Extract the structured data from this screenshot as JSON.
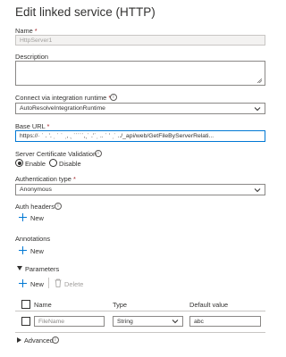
{
  "panel": {
    "title": "Edit linked service (HTTP)"
  },
  "name": {
    "label": "Name",
    "required_mark": "*",
    "value": "HttpServer1"
  },
  "description": {
    "label": "Description",
    "value": ""
  },
  "runtime": {
    "label": "Connect via integration runtime",
    "required_mark": "*",
    "selected": "AutoResolveIntegrationRuntime"
  },
  "base_url": {
    "label": "Base URL",
    "required_mark": "*",
    "value": "https://· ˙ . ʼ. ˌ ˙ ˙ ˌ, ˎ ˙˙˙˙˙,ˎ˙ .ʼ˙ˌ .. ˙ ʽ ˌ˙ ../_api/web/GetFileByServerRelati..."
  },
  "server_cert": {
    "label": "Server Certificate Validation",
    "options": [
      "Enable",
      "Disable"
    ],
    "selected": "Enable"
  },
  "auth_type": {
    "label": "Authentication type",
    "required_mark": "*",
    "selected": "Anonymous"
  },
  "auth_headers": {
    "label": "Auth headers",
    "new_label": "New"
  },
  "annotations": {
    "label": "Annotations",
    "new_label": "New"
  },
  "parameters": {
    "label": "Parameters",
    "new_label": "New",
    "delete_label": "Delete",
    "columns": [
      "Name",
      "Type",
      "Default value"
    ],
    "rows": [
      {
        "name_placeholder": "FileName",
        "type": "String",
        "default_value": "abc"
      }
    ]
  },
  "advanced": {
    "label": "Advanced"
  },
  "colors": {
    "accent": "#0078d4",
    "required": "#a4262c"
  },
  "icons": [
    "info-icon",
    "chevron-down-icon",
    "plus-icon",
    "trash-icon",
    "caret-icon"
  ]
}
